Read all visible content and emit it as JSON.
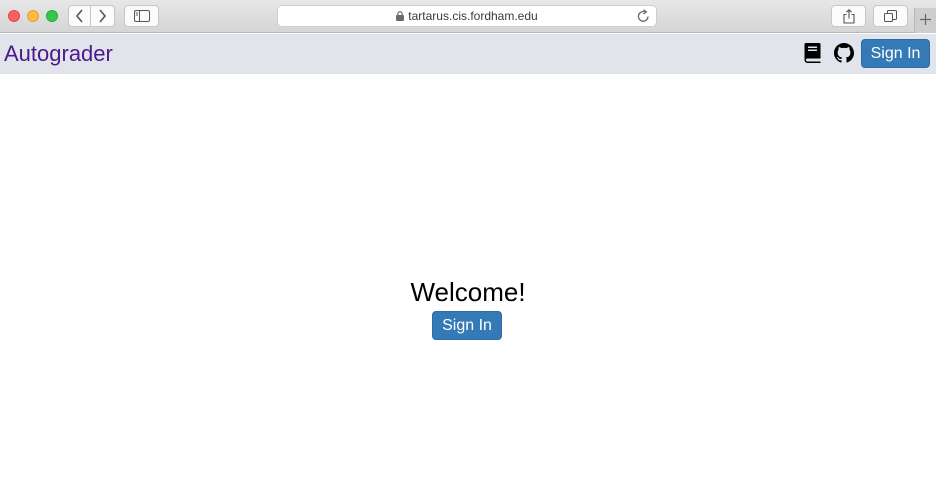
{
  "browser": {
    "url": "tartarus.cis.fordham.edu",
    "icons": {
      "back": "chevron-left-icon",
      "forward": "chevron-right-icon",
      "sidebar": "sidebar-icon",
      "lock": "lock-icon",
      "reload": "reload-icon",
      "share": "share-icon",
      "tabs": "tabs-overview-icon",
      "new_tab": "plus-icon"
    }
  },
  "navbar": {
    "brand": "Autograder",
    "icons": {
      "docs": "book-icon",
      "source": "github-icon"
    },
    "sign_in_label": "Sign In"
  },
  "main": {
    "heading": "Welcome!",
    "sign_in_label": "Sign In"
  },
  "colors": {
    "brand": "#4b1a8a",
    "navbar_bg": "#e1e4ea",
    "primary_button": "#337ab7"
  }
}
